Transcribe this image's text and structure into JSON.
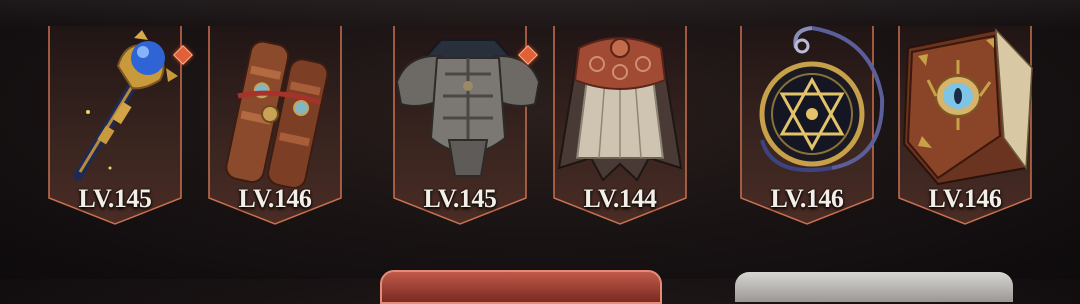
{
  "equipment": [
    {
      "item": "staff",
      "level": "LV.145",
      "new_badge": true
    },
    {
      "item": "bracers",
      "level": "LV.146",
      "new_badge": false
    },
    {
      "item": "chest-armor",
      "level": "LV.145",
      "new_badge": true
    },
    {
      "item": "cloak",
      "level": "LV.144",
      "new_badge": false
    },
    {
      "item": "amulet",
      "level": "LV.146",
      "new_badge": false
    },
    {
      "item": "tome",
      "level": "LV.146",
      "new_badge": false
    }
  ],
  "colors": {
    "frame_border": "#c9714f",
    "frame_fill": "#3b2620",
    "badge": "#e0603a",
    "level_text": "#f3efe8"
  }
}
